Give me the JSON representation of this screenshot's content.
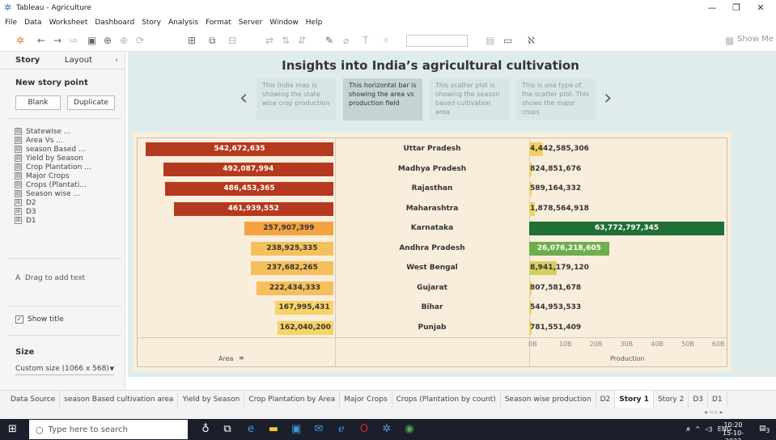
{
  "window": {
    "title": "Tableau - Agriculture"
  },
  "menu": [
    "File",
    "Data",
    "Worksheet",
    "Dashboard",
    "Story",
    "Analysis",
    "Format",
    "Server",
    "Window",
    "Help"
  ],
  "toolbar": {
    "show_me": "Show Me"
  },
  "left_panel": {
    "tabs": [
      "Story",
      "Layout"
    ],
    "new_story_point": "New story point",
    "blank": "Blank",
    "duplicate": "Duplicate",
    "sheets": [
      "Statewise ...",
      "Area Vs ...",
      "season Based ...",
      "Yield by Season",
      "Crop Plantation ...",
      "Major Crops",
      "Crops (Plantati...",
      "Season wise ...",
      "D2",
      "D3",
      "D1"
    ],
    "drag_text": "Drag to add text",
    "show_title": "Show title",
    "size_heading": "Size",
    "size_value": "Custom size (1066 x 568)"
  },
  "story": {
    "title": "Insights into India’s agricultural cultivation",
    "points": [
      "This India map is showing the state wise crop production",
      "This horizontal bar is showing the area vs production field",
      "This scatter plot is showing the season based cultivation area",
      "This is one type of the scatter plot. This shows the major crops"
    ]
  },
  "chart_data": {
    "type": "bar",
    "categories": [
      "Uttar Pradesh",
      "Madhya Pradesh",
      "Rajasthan",
      "Maharashtra",
      "Karnataka",
      "Andhra Pradesh",
      "West Bengal",
      "Gujarat",
      "Bihar",
      "Punjab"
    ],
    "series": [
      {
        "name": "Area",
        "values": [
          542672635,
          492087994,
          486453365,
          461939552,
          257907399,
          238925335,
          237682265,
          222434333,
          167995431,
          162040200
        ]
      },
      {
        "name": "Production",
        "values": [
          4442585306,
          824851676,
          589164332,
          1878564918,
          63772797345,
          26076218605,
          8941179120,
          807581678,
          544953533,
          781551409
        ]
      }
    ],
    "area_labels": [
      "542,672,635",
      "492,087,994",
      "486,453,365",
      "461,939,552",
      "257,907,399",
      "238,925,335",
      "237,682,265",
      "222,434,333",
      "167,995,431",
      "162,040,200"
    ],
    "production_labels": [
      "4,442,585,306",
      "824,851,676",
      "589,164,332",
      "1,878,564,918",
      "63,772,797,345",
      "26,076,218,605",
      "8,941,179,120",
      "807,581,678",
      "544,953,533",
      "781,551,409"
    ],
    "area_colors": [
      "#b5391e",
      "#b5391e",
      "#b5391e",
      "#b5391e",
      "#f4a340",
      "#f5c05c",
      "#f5c05c",
      "#f5c05c",
      "#f7d366",
      "#f7d366"
    ],
    "production_colors": [
      "#f2d163",
      "#f2d163",
      "#f2d163",
      "#f2d163",
      "#1f6f36",
      "#6fae4d",
      "#d5cf60",
      "#f2d163",
      "#f2d163",
      "#f2d163"
    ],
    "production_ticks": [
      "0B",
      "10B",
      "20B",
      "30B",
      "40B",
      "50B",
      "60B"
    ],
    "production_tick_values": [
      0,
      10000000000,
      20000000000,
      30000000000,
      40000000000,
      50000000000,
      60000000000
    ],
    "xlabel_area": "Area",
    "xlabel_production": "Production",
    "area_max": 542672635,
    "production_max": 64000000000
  },
  "bottom_tabs": [
    "Data Source",
    "season Based cultivation area",
    "Yield by Season",
    "Crop Plantation by Area",
    "Major Crops",
    "Crops (Plantation by count)",
    "Season wise production",
    "D2",
    "Story 1",
    "Story 2",
    "D3",
    "D1"
  ],
  "active_tab": "Story 1",
  "taskbar": {
    "search_placeholder": "Type here to search",
    "lang": "ENG",
    "time": "10:20",
    "date": "15-10-2023",
    "notifications": "3"
  }
}
